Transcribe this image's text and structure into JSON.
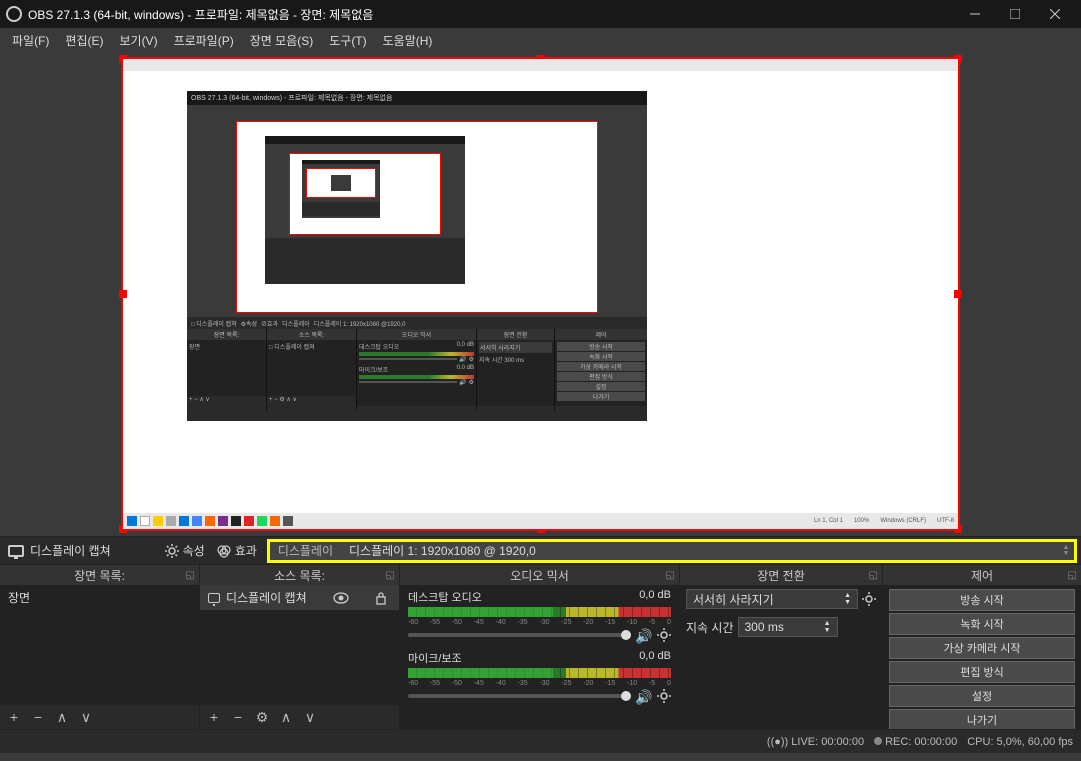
{
  "window": {
    "title": "OBS 27.1.3 (64-bit, windows) - 프로파일: 제목없음 - 장면: 제목없음"
  },
  "menu": {
    "file": "파일(F)",
    "edit": "편집(E)",
    "view": "보기(V)",
    "profile": "프로파일(P)",
    "scene_collection": "장면 모음(S)",
    "tools": "도구(T)",
    "help": "도움말(H)"
  },
  "toolbar": {
    "source_name": "디스플레이 캡쳐",
    "properties": "속성",
    "filters": "효과",
    "display_label": "디스플레이",
    "display_value": "디스플레이 1: 1920x1080 @ 1920,0"
  },
  "panels": {
    "scenes": {
      "title": "장면 목록:",
      "items": [
        "장면"
      ]
    },
    "sources": {
      "title": "소스 목록:",
      "items": [
        "디스플레이 캡쳐"
      ]
    },
    "mixer": {
      "title": "오디오 믹서",
      "channels": [
        {
          "name": "데스크탑 오디오",
          "level": "0,0 dB"
        },
        {
          "name": "마이크/보조",
          "level": "0,0 dB"
        }
      ],
      "scale_ticks": [
        "-60",
        "-55",
        "-50",
        "-45",
        "-40",
        "-35",
        "-30",
        "-25",
        "-20",
        "-15",
        "-10",
        "-5",
        "0"
      ]
    },
    "transitions": {
      "title": "장면 전환",
      "type": "서서히 사라지기",
      "duration_label": "지속 시간",
      "duration_value": "300 ms"
    },
    "controls": {
      "title": "제어",
      "buttons": [
        "방송 시작",
        "녹화 시작",
        "가상 카메라 시작",
        "편집 방식",
        "설정",
        "나가기"
      ]
    }
  },
  "status": {
    "live": "LIVE: 00:00:00",
    "rec": "REC: 00:00:00",
    "cpu": "CPU: 5,0%, 60,00 fps"
  }
}
